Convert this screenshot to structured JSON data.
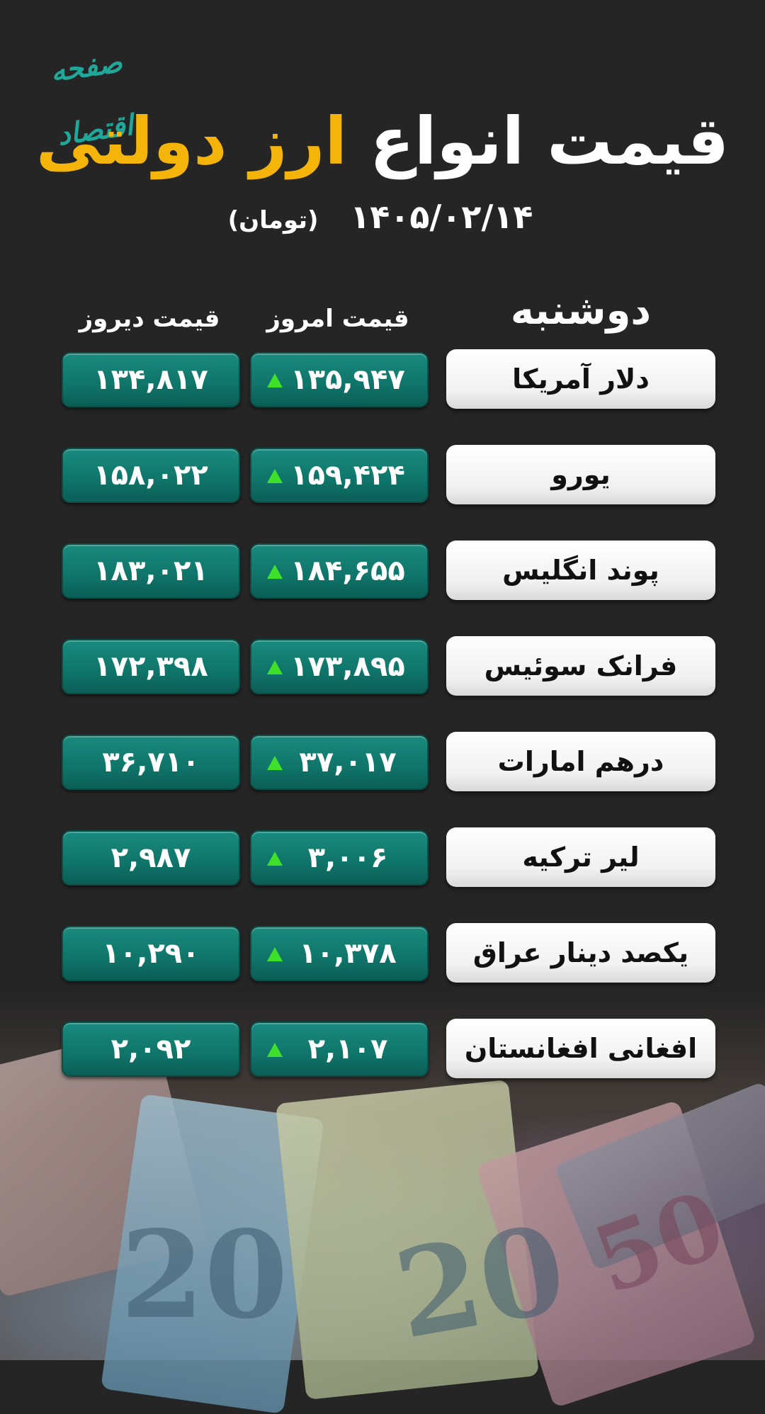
{
  "logo": "صفحه اقتصاد",
  "title": {
    "part1": "قیمت انواع",
    "part2": "ارز دولتی"
  },
  "date": "۱۴۰۵/۰۲/۱۴",
  "unit": "(تومان)",
  "headers": {
    "day": "دوشنبه",
    "today": "قیمت امروز",
    "yesterday": "قیمت دیروز"
  },
  "rows": [
    {
      "name": "دلار آمریکا",
      "today": "۱۳۵,۹۴۷",
      "yesterday": "۱۳۴,۸۱۷",
      "trend": "up"
    },
    {
      "name": "یورو",
      "today": "۱۵۹,۴۲۴",
      "yesterday": "۱۵۸,۰۲۲",
      "trend": "up"
    },
    {
      "name": "پوند انگلیس",
      "today": "۱۸۴,۶۵۵",
      "yesterday": "۱۸۳,۰۲۱",
      "trend": "up"
    },
    {
      "name": "فرانک سوئیس",
      "today": "۱۷۳,۸۹۵",
      "yesterday": "۱۷۲,۳۹۸",
      "trend": "up"
    },
    {
      "name": "درهم امارات",
      "today": "۳۷,۰۱۷",
      "yesterday": "۳۶,۷۱۰",
      "trend": "up"
    },
    {
      "name": "لیر ترکیه",
      "today": "۳,۰۰۶",
      "yesterday": "۲,۹۸۷",
      "trend": "up"
    },
    {
      "name": "یکصد دینار عراق",
      "today": "۱۰,۳۷۸",
      "yesterday": "۱۰,۲۹۰",
      "trend": "up"
    },
    {
      "name": "افغانی افغانستان",
      "today": "۲,۱۰۷",
      "yesterday": "۲,۰۹۲",
      "trend": "up"
    }
  ],
  "colors": {
    "accent": "#f5b40a",
    "price_box": "#0f7469",
    "up_arrow": "#3fe02a",
    "logo": "#1fa89a"
  },
  "background_art": {
    "banknote_numerals": [
      "20",
      "20",
      "50"
    ]
  }
}
